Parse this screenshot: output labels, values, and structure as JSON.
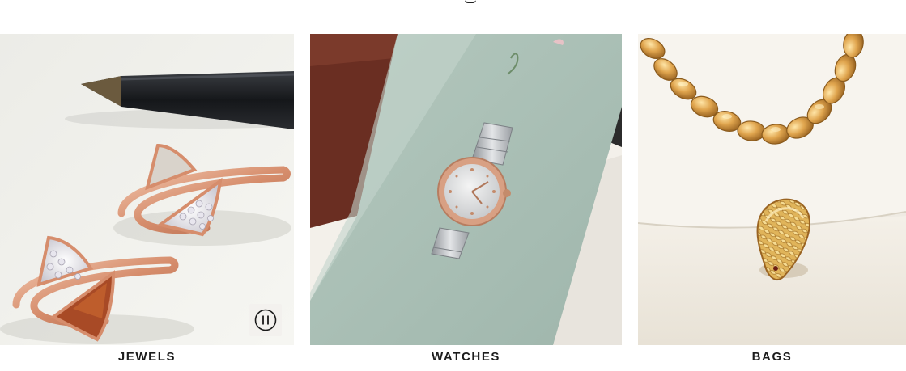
{
  "categories": [
    {
      "label": "JEWELS",
      "image": "rings-with-pen-photo"
    },
    {
      "label": "WATCHES",
      "image": "watch-on-card-photo"
    },
    {
      "label": "BAGS",
      "image": "chain-bag-snake-clasp-photo"
    }
  ],
  "video_control": {
    "icon": "pause-icon",
    "state": "playing"
  },
  "colors": {
    "label_text": "#1c1c1c",
    "rose_gold": "#d89878",
    "sage_card": "#a6bcb2",
    "bag_cream": "#f1ece2",
    "gold_chain": "#d9a04a"
  }
}
